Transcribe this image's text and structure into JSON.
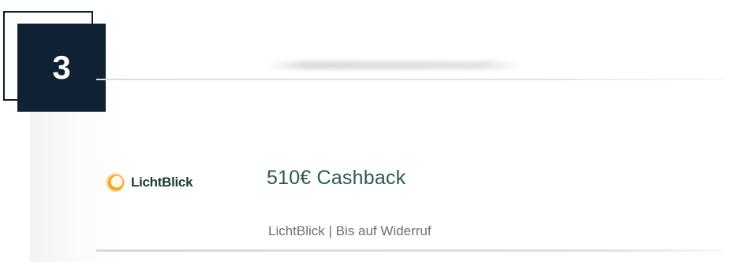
{
  "step": {
    "number": "3"
  },
  "offer": {
    "provider_logo_text": "LichtBlick",
    "title": "510€ Cashback",
    "meta": "LichtBlick | Bis auf Widerruf"
  },
  "colors": {
    "badge_background": "#0f2133",
    "title_color": "#2c5a52",
    "logo_orange": "#f2a516"
  },
  "icons": {
    "provider_logo": "lichtblick-logo-icon"
  }
}
